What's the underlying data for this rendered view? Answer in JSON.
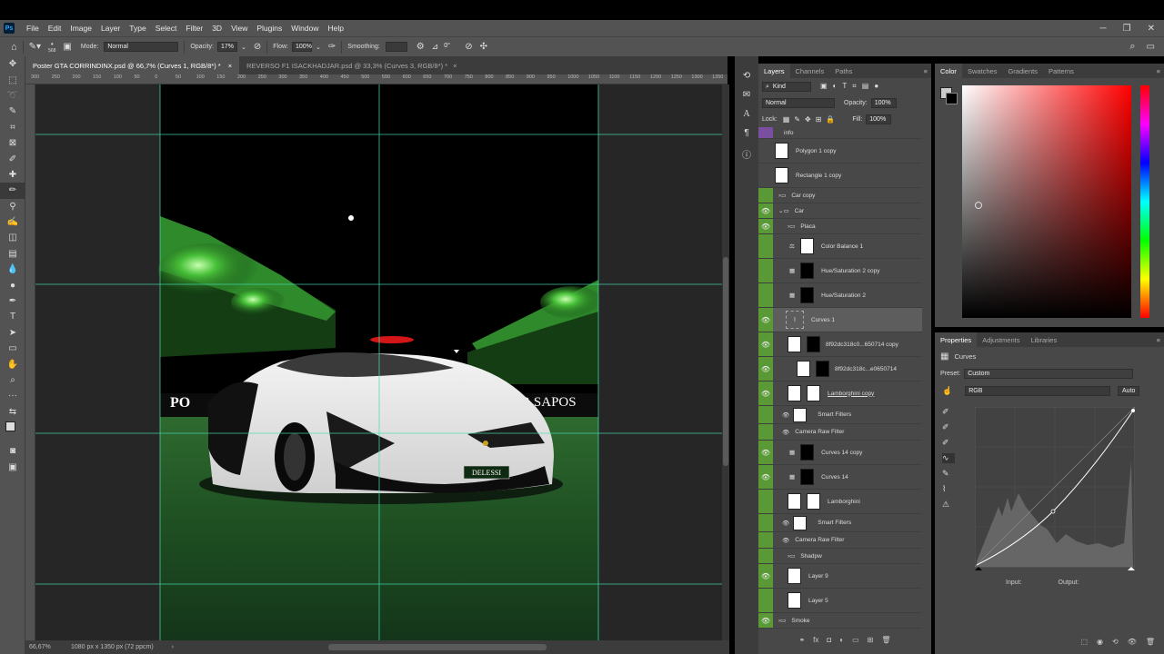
{
  "menu": {
    "logo": "Ps",
    "items": [
      "File",
      "Edit",
      "Image",
      "Layer",
      "Type",
      "Select",
      "Filter",
      "3D",
      "View",
      "Plugins",
      "Window",
      "Help"
    ]
  },
  "options": {
    "brush_size": "568",
    "mode_label": "Mode:",
    "mode": "Normal",
    "opacity_label": "Opacity:",
    "opacity": "17%",
    "flow_label": "Flow:",
    "flow": "100%",
    "smoothing_label": "Smoothing:",
    "smoothing": "",
    "angle": "0°"
  },
  "tabs": [
    {
      "label": "Poster GTA CORRINDINX.psd @ 66,7% (Curves 1, RGB/8*) *",
      "close": "×"
    },
    {
      "label": "REVERSO F1 ISACKHADJAR.psd @ 33,3% (Curves 3, RGB/8*) *",
      "close": "×"
    }
  ],
  "ruler": [
    "300",
    "250",
    "200",
    "150",
    "100",
    "50",
    "0",
    "50",
    "100",
    "150",
    "200",
    "250",
    "300",
    "350",
    "400",
    "450",
    "500",
    "550",
    "600",
    "650",
    "700",
    "750",
    "800",
    "850",
    "900",
    "950",
    "1000",
    "1050",
    "1100",
    "1150",
    "1200",
    "1250",
    "1300",
    "1350"
  ],
  "canvas": {
    "banner_left": "PO",
    "banner_right": "ER SAPOS",
    "plate": "DELESSI"
  },
  "status": {
    "zoom": "66,67%",
    "doc": "1080 px x 1350 px (72 ppcm)"
  },
  "layers": {
    "tabs": [
      "Layers",
      "Channels",
      "Paths"
    ],
    "kind": "Kind",
    "blend": "Normal",
    "opacity_label": "Opacity:",
    "opacity": "100%",
    "lock_label": "Lock:",
    "fill_label": "Fill:",
    "fill": "100%",
    "rows": [
      {
        "name": "info"
      },
      {
        "name": "Polygon 1 copy"
      },
      {
        "name": "Rectangle 1 copy"
      },
      {
        "name": "Car copy"
      },
      {
        "name": "Car"
      },
      {
        "name": "Placa"
      },
      {
        "name": "Color Balance 1"
      },
      {
        "name": "Hue/Saturation 2 copy"
      },
      {
        "name": "Hue/Saturation 2"
      },
      {
        "name": "Curves 1"
      },
      {
        "name": "8f92dc318c0...650714 copy"
      },
      {
        "name": "8f92dc318c...e0650714"
      },
      {
        "name": "Lamborghini copy"
      },
      {
        "name": "Smart Filters"
      },
      {
        "name": "Camera Raw Filter"
      },
      {
        "name": "Curves 14 copy"
      },
      {
        "name": "Curves 14"
      },
      {
        "name": "Lamborghini"
      },
      {
        "name": "Smart Filters"
      },
      {
        "name": "Camera Raw Filter"
      },
      {
        "name": "Shadpw"
      },
      {
        "name": "Layer 9"
      },
      {
        "name": "Layer 5"
      },
      {
        "name": "Smoke"
      }
    ]
  },
  "color": {
    "tabs": [
      "Color",
      "Swatches",
      "Gradients",
      "Patterns"
    ],
    "hue": "#ff0000"
  },
  "properties": {
    "tabs": [
      "Properties",
      "Adjustments",
      "Libraries"
    ],
    "title": "Curves",
    "preset_label": "Preset:",
    "preset": "Custom",
    "channel": "RGB",
    "auto": "Auto",
    "input": "Input:",
    "output": "Output:"
  }
}
